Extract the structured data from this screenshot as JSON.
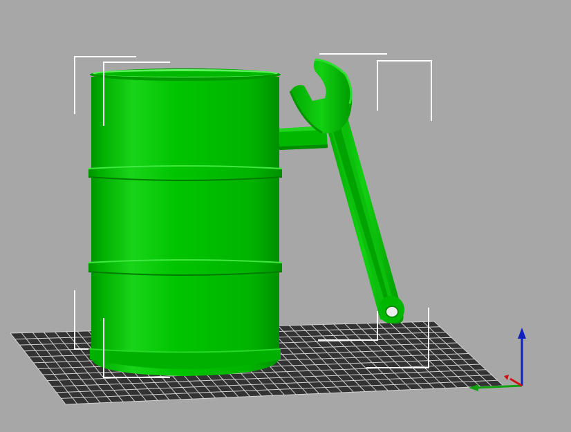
{
  "viewport": {
    "background": "#a7a7a7",
    "bed_color": "#3a3a3a",
    "grid_line_color": "#d8d8d8",
    "bbox_color": "#ffffff"
  },
  "model": {
    "color": "#00c000",
    "highlight": "#2fdc2f",
    "shadow": "#008d00",
    "parts": [
      "barrel",
      "wrench-handle"
    ]
  },
  "axes": {
    "x_color": "#d01010",
    "y_color": "#10a010",
    "z_color": "#1020c0",
    "icon": "xyz-axes-icon"
  }
}
